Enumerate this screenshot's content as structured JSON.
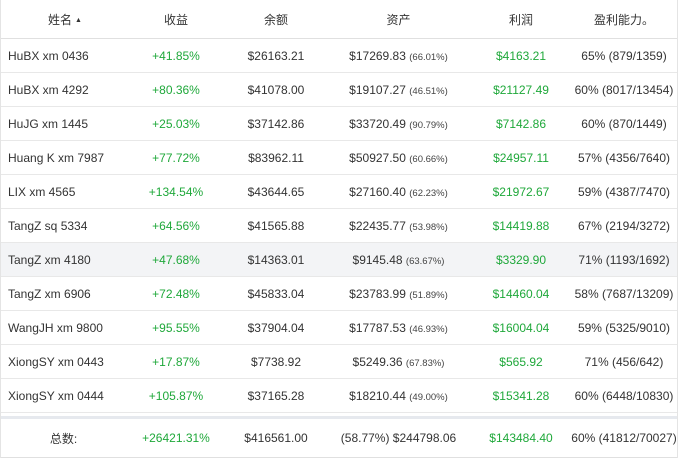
{
  "header": {
    "name": "姓名",
    "gain": "收益",
    "balance": "余额",
    "assets": "资产",
    "profit": "利润",
    "ability": "盈利能力。"
  },
  "rows": [
    {
      "name": "HuBX xm 0436",
      "gain": "+41.85%",
      "balance": "$26163.21",
      "assets": "$17269.83",
      "assets_pct": "(66.01%)",
      "profit": "$4163.21",
      "ability": "65% (879/1359)"
    },
    {
      "name": "HuBX xm 4292",
      "gain": "+80.36%",
      "balance": "$41078.00",
      "assets": "$19107.27",
      "assets_pct": "(46.51%)",
      "profit": "$21127.49",
      "ability": "60% (8017/13454)"
    },
    {
      "name": "HuJG xm 1445",
      "gain": "+25.03%",
      "balance": "$37142.86",
      "assets": "$33720.49",
      "assets_pct": "(90.79%)",
      "profit": "$7142.86",
      "ability": "60% (870/1449)"
    },
    {
      "name": "Huang K xm 7987",
      "gain": "+77.72%",
      "balance": "$83962.11",
      "assets": "$50927.50",
      "assets_pct": "(60.66%)",
      "profit": "$24957.11",
      "ability": "57% (4356/7640)"
    },
    {
      "name": "LIX xm 4565",
      "gain": "+134.54%",
      "balance": "$43644.65",
      "assets": "$27160.40",
      "assets_pct": "(62.23%)",
      "profit": "$21972.67",
      "ability": "59% (4387/7470)"
    },
    {
      "name": "TangZ sq 5334",
      "gain": "+64.56%",
      "balance": "$41565.88",
      "assets": "$22435.77",
      "assets_pct": "(53.98%)",
      "profit": "$14419.88",
      "ability": "67% (2194/3272)"
    },
    {
      "name": "TangZ xm 4180",
      "gain": "+47.68%",
      "balance": "$14363.01",
      "assets": "$9145.48",
      "assets_pct": "(63.67%)",
      "profit": "$3329.90",
      "ability": "71% (1193/1692)"
    },
    {
      "name": "TangZ xm 6906",
      "gain": "+72.48%",
      "balance": "$45833.04",
      "assets": "$23783.99",
      "assets_pct": "(51.89%)",
      "profit": "$14460.04",
      "ability": "58% (7687/13209)"
    },
    {
      "name": "WangJH xm 9800",
      "gain": "+95.55%",
      "balance": "$37904.04",
      "assets": "$17787.53",
      "assets_pct": "(46.93%)",
      "profit": "$16004.04",
      "ability": "59% (5325/9010)"
    },
    {
      "name": "XiongSY xm 0443",
      "gain": "+17.87%",
      "balance": "$7738.92",
      "assets": "$5249.36",
      "assets_pct": "(67.83%)",
      "profit": "$565.92",
      "ability": "71% (456/642)"
    },
    {
      "name": "XiongSY xm 0444",
      "gain": "+105.87%",
      "balance": "$37165.28",
      "assets": "$18210.44",
      "assets_pct": "(49.00%)",
      "profit": "$15341.28",
      "ability": "60% (6448/10830)"
    }
  ],
  "footer": {
    "label": "总数:",
    "gain": "+26421.31%",
    "balance": "$416561.00",
    "assets": "(58.77%) $244798.06",
    "profit": "$143484.40",
    "ability": "60% (41812/70027)"
  },
  "colors": {
    "positive": "#1fa83a",
    "highlight_row": "#f3f4f6",
    "border": "#e8e8e8"
  }
}
